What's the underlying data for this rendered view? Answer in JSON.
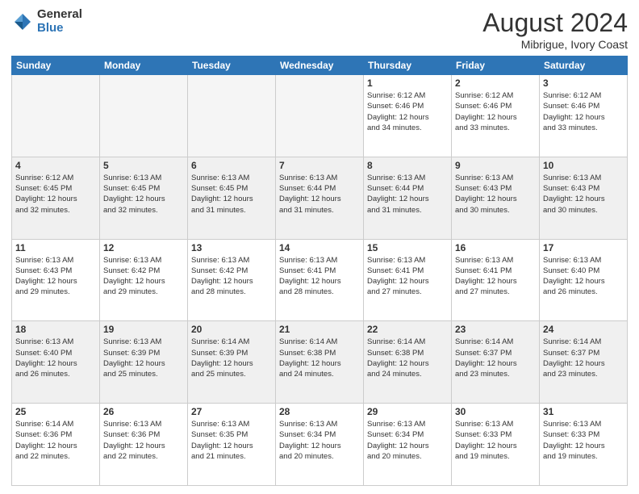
{
  "logo": {
    "general": "General",
    "blue": "Blue"
  },
  "header": {
    "month": "August 2024",
    "location": "Mibrigue, Ivory Coast"
  },
  "weekdays": [
    "Sunday",
    "Monday",
    "Tuesday",
    "Wednesday",
    "Thursday",
    "Friday",
    "Saturday"
  ],
  "weeks": [
    [
      {
        "day": "",
        "info": ""
      },
      {
        "day": "",
        "info": ""
      },
      {
        "day": "",
        "info": ""
      },
      {
        "day": "",
        "info": ""
      },
      {
        "day": "1",
        "info": "Sunrise: 6:12 AM\nSunset: 6:46 PM\nDaylight: 12 hours\nand 34 minutes."
      },
      {
        "day": "2",
        "info": "Sunrise: 6:12 AM\nSunset: 6:46 PM\nDaylight: 12 hours\nand 33 minutes."
      },
      {
        "day": "3",
        "info": "Sunrise: 6:12 AM\nSunset: 6:46 PM\nDaylight: 12 hours\nand 33 minutes."
      }
    ],
    [
      {
        "day": "4",
        "info": "Sunrise: 6:12 AM\nSunset: 6:45 PM\nDaylight: 12 hours\nand 32 minutes."
      },
      {
        "day": "5",
        "info": "Sunrise: 6:13 AM\nSunset: 6:45 PM\nDaylight: 12 hours\nand 32 minutes."
      },
      {
        "day": "6",
        "info": "Sunrise: 6:13 AM\nSunset: 6:45 PM\nDaylight: 12 hours\nand 31 minutes."
      },
      {
        "day": "7",
        "info": "Sunrise: 6:13 AM\nSunset: 6:44 PM\nDaylight: 12 hours\nand 31 minutes."
      },
      {
        "day": "8",
        "info": "Sunrise: 6:13 AM\nSunset: 6:44 PM\nDaylight: 12 hours\nand 31 minutes."
      },
      {
        "day": "9",
        "info": "Sunrise: 6:13 AM\nSunset: 6:43 PM\nDaylight: 12 hours\nand 30 minutes."
      },
      {
        "day": "10",
        "info": "Sunrise: 6:13 AM\nSunset: 6:43 PM\nDaylight: 12 hours\nand 30 minutes."
      }
    ],
    [
      {
        "day": "11",
        "info": "Sunrise: 6:13 AM\nSunset: 6:43 PM\nDaylight: 12 hours\nand 29 minutes."
      },
      {
        "day": "12",
        "info": "Sunrise: 6:13 AM\nSunset: 6:42 PM\nDaylight: 12 hours\nand 29 minutes."
      },
      {
        "day": "13",
        "info": "Sunrise: 6:13 AM\nSunset: 6:42 PM\nDaylight: 12 hours\nand 28 minutes."
      },
      {
        "day": "14",
        "info": "Sunrise: 6:13 AM\nSunset: 6:41 PM\nDaylight: 12 hours\nand 28 minutes."
      },
      {
        "day": "15",
        "info": "Sunrise: 6:13 AM\nSunset: 6:41 PM\nDaylight: 12 hours\nand 27 minutes."
      },
      {
        "day": "16",
        "info": "Sunrise: 6:13 AM\nSunset: 6:41 PM\nDaylight: 12 hours\nand 27 minutes."
      },
      {
        "day": "17",
        "info": "Sunrise: 6:13 AM\nSunset: 6:40 PM\nDaylight: 12 hours\nand 26 minutes."
      }
    ],
    [
      {
        "day": "18",
        "info": "Sunrise: 6:13 AM\nSunset: 6:40 PM\nDaylight: 12 hours\nand 26 minutes."
      },
      {
        "day": "19",
        "info": "Sunrise: 6:13 AM\nSunset: 6:39 PM\nDaylight: 12 hours\nand 25 minutes."
      },
      {
        "day": "20",
        "info": "Sunrise: 6:14 AM\nSunset: 6:39 PM\nDaylight: 12 hours\nand 25 minutes."
      },
      {
        "day": "21",
        "info": "Sunrise: 6:14 AM\nSunset: 6:38 PM\nDaylight: 12 hours\nand 24 minutes."
      },
      {
        "day": "22",
        "info": "Sunrise: 6:14 AM\nSunset: 6:38 PM\nDaylight: 12 hours\nand 24 minutes."
      },
      {
        "day": "23",
        "info": "Sunrise: 6:14 AM\nSunset: 6:37 PM\nDaylight: 12 hours\nand 23 minutes."
      },
      {
        "day": "24",
        "info": "Sunrise: 6:14 AM\nSunset: 6:37 PM\nDaylight: 12 hours\nand 23 minutes."
      }
    ],
    [
      {
        "day": "25",
        "info": "Sunrise: 6:14 AM\nSunset: 6:36 PM\nDaylight: 12 hours\nand 22 minutes."
      },
      {
        "day": "26",
        "info": "Sunrise: 6:13 AM\nSunset: 6:36 PM\nDaylight: 12 hours\nand 22 minutes."
      },
      {
        "day": "27",
        "info": "Sunrise: 6:13 AM\nSunset: 6:35 PM\nDaylight: 12 hours\nand 21 minutes."
      },
      {
        "day": "28",
        "info": "Sunrise: 6:13 AM\nSunset: 6:34 PM\nDaylight: 12 hours\nand 20 minutes."
      },
      {
        "day": "29",
        "info": "Sunrise: 6:13 AM\nSunset: 6:34 PM\nDaylight: 12 hours\nand 20 minutes."
      },
      {
        "day": "30",
        "info": "Sunrise: 6:13 AM\nSunset: 6:33 PM\nDaylight: 12 hours\nand 19 minutes."
      },
      {
        "day": "31",
        "info": "Sunrise: 6:13 AM\nSunset: 6:33 PM\nDaylight: 12 hours\nand 19 minutes."
      }
    ]
  ]
}
